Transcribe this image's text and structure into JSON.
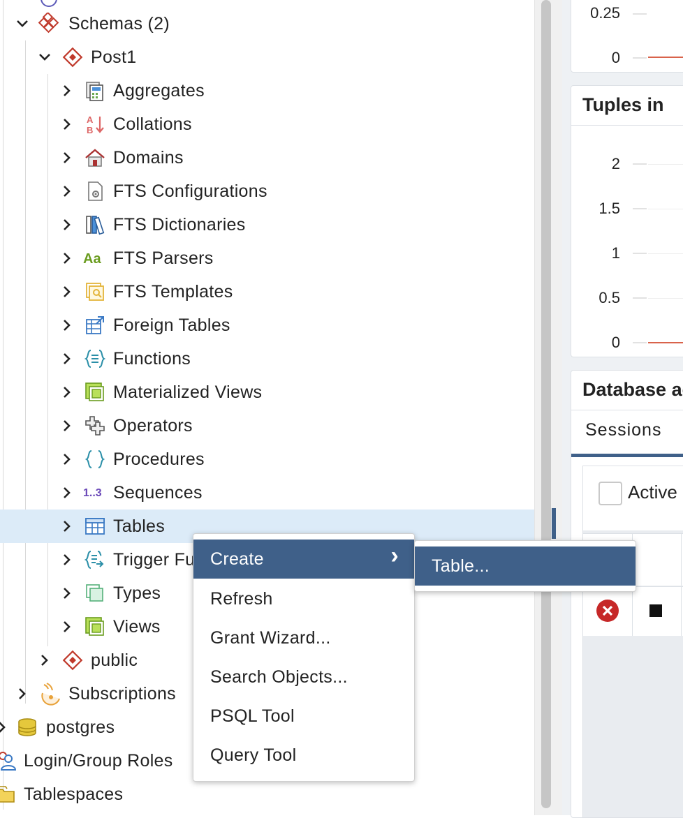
{
  "tree": {
    "schemas_label": "Schemas (2)",
    "schema_label": "Post1",
    "items": [
      {
        "label": "Aggregates",
        "icon": "aggregates-icon"
      },
      {
        "label": "Collations",
        "icon": "collations-icon"
      },
      {
        "label": "Domains",
        "icon": "domains-icon"
      },
      {
        "label": "FTS Configurations",
        "icon": "fts-configurations-icon"
      },
      {
        "label": "FTS Dictionaries",
        "icon": "fts-dictionaries-icon"
      },
      {
        "label": "FTS Parsers",
        "icon": "fts-parsers-icon"
      },
      {
        "label": "FTS Templates",
        "icon": "fts-templates-icon"
      },
      {
        "label": "Foreign Tables",
        "icon": "foreign-tables-icon"
      },
      {
        "label": "Functions",
        "icon": "functions-icon"
      },
      {
        "label": "Materialized Views",
        "icon": "materialized-views-icon"
      },
      {
        "label": "Operators",
        "icon": "operators-icon"
      },
      {
        "label": "Procedures",
        "icon": "procedures-icon"
      },
      {
        "label": "Sequences",
        "icon": "sequences-icon"
      },
      {
        "label": "Tables",
        "icon": "tables-icon"
      },
      {
        "label": "Trigger Fu",
        "icon": "trigger-functions-icon"
      },
      {
        "label": "Types",
        "icon": "types-icon"
      },
      {
        "label": "Views",
        "icon": "views-icon"
      }
    ],
    "public_label": "public",
    "subscriptions_label": "Subscriptions",
    "postgres_label": "postgres",
    "login_roles_label": "Login/Group Roles",
    "tablespaces_label": "Tablespaces",
    "collations_glyph_top": "A",
    "collations_glyph_bottom": "B",
    "fts_parsers_glyph": "Aa",
    "sequences_glyph": "1..3"
  },
  "context_menu": {
    "items": [
      "Create",
      "Refresh",
      "Grant Wizard...",
      "Search Objects...",
      "PSQL Tool",
      "Query Tool"
    ],
    "submenu_arrow": "›",
    "submenu": [
      "Table..."
    ]
  },
  "dashboard": {
    "chart1_ticks": [
      "0.25",
      "0"
    ],
    "tuples_in_title": "Tuples in",
    "tuples_in_ticks": [
      "2",
      "1.5",
      "1",
      "0.5",
      "0"
    ],
    "database_activity_title": "Database ac",
    "sessions_tab": "Sessions",
    "active_label": "Active",
    "line_color": "#d9634b",
    "selection_color": "#3f6089"
  },
  "colors": {
    "menu_active_bg": "#3f6089",
    "tree_selected_bg": "#dcebf8"
  }
}
